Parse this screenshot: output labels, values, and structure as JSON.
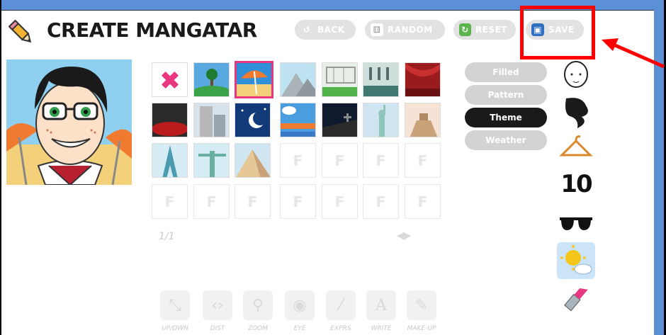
{
  "header": {
    "title": "CREATE MANGATAR",
    "buttons": {
      "back": "BACK",
      "random": "RANDOM",
      "reset": "RESET",
      "save": "SAVE"
    }
  },
  "categories": [
    {
      "label": "Filled",
      "active": false
    },
    {
      "label": "Pattern",
      "active": false
    },
    {
      "label": "Theme",
      "active": true
    },
    {
      "label": "Weather",
      "active": false
    }
  ],
  "side_icons": [
    "head-icon",
    "hair-icon",
    "clothes-hanger-icon",
    "number-10-icon",
    "sunglasses-icon",
    "weather-background-icon",
    "lipstick-icon"
  ],
  "side_number_label": "10",
  "pager": "1/1",
  "tools": [
    {
      "label": "UP/DWN",
      "icon": "resize-icon"
    },
    {
      "label": "DIST",
      "icon": "distance-icon"
    },
    {
      "label": "ZOOM",
      "icon": "zoom-icon"
    },
    {
      "label": "EYE",
      "icon": "eye-icon"
    },
    {
      "label": "EXPRS",
      "icon": "expression-icon"
    },
    {
      "label": "WRITE",
      "icon": "write-icon"
    },
    {
      "label": "MAKE-UP",
      "icon": "makeup-icon"
    }
  ],
  "empty_cell_letter": "F",
  "colors": {
    "accent_selected": "#e8377f",
    "active_category": "#1a1a1a",
    "highlight_box": "#ff0000",
    "frame_blue": "#5b8fd6"
  }
}
